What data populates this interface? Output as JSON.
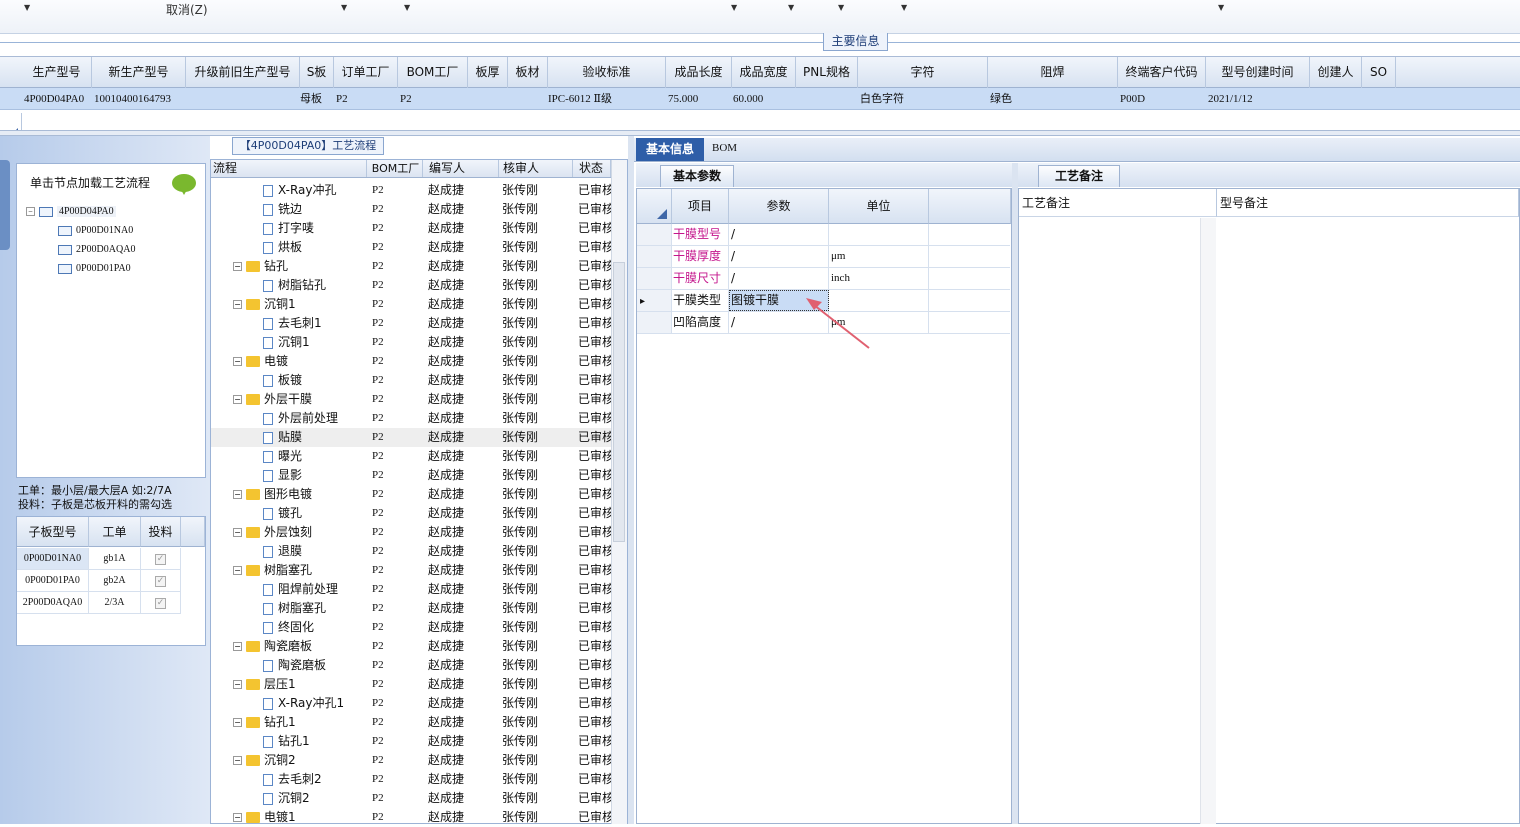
{
  "toolbar": {
    "cancel_label": "取消(Z)",
    "dropdown_glyph": "▼"
  },
  "main_info": {
    "title": "主要信息",
    "columns": [
      "生产型号",
      "新生产型号",
      "升级前旧生产型号",
      "S板",
      "订单工厂",
      "BOM工厂",
      "板厚",
      "板材",
      "验收标准",
      "成品长度",
      "成品宽度",
      "PNL规格",
      "字符",
      "阻焊",
      "终端客户代码",
      "型号创建时间",
      "创建人",
      "SO"
    ],
    "row": {
      "prod_no": "4P00D04PA0",
      "new_prod_no": "10010400164793",
      "s_board": "母板",
      "order_factory": "P2",
      "bom_factory": "P2",
      "standard": "IPC-6012 Ⅱ级",
      "length": "75.000",
      "width": "60.000",
      "char": "白色字符",
      "mask": "绿色",
      "customer": "P00D",
      "created": "2021/1/12"
    }
  },
  "left": {
    "load_hint": "单击节点加载工艺流程",
    "tree_root": "4P00D04PA0",
    "tree_children": [
      "0P00D01NA0",
      "2P00D0AQA0",
      "0P00D01PA0"
    ],
    "order_line1": "工单：最小层/最大层A 如:2/7A",
    "order_line2": "投料：子板是芯板开料的需勾选",
    "subgrid_headers": [
      "子板型号",
      "工单",
      "投料"
    ],
    "subgrid_rows": [
      {
        "model": "0P00D01NA0",
        "order": "gb1A",
        "checked": true
      },
      {
        "model": "0P00D01PA0",
        "order": "gb2A",
        "checked": true
      },
      {
        "model": "2P00D0AQA0",
        "order": "2/3A",
        "checked": true
      }
    ]
  },
  "process": {
    "title": "【4P00D04PA0】工艺流程",
    "headers": [
      "流程",
      "BOM工厂",
      "编写人",
      "核审人",
      "状态"
    ],
    "factory": "P2",
    "writer": "赵成捷",
    "reviewer": "张传刚",
    "status": "已审核",
    "rows": [
      {
        "name": "X-Ray冲孔",
        "type": "doc"
      },
      {
        "name": "铣边",
        "type": "doc"
      },
      {
        "name": "打字唛",
        "type": "doc"
      },
      {
        "name": "烘板",
        "type": "doc"
      },
      {
        "name": "钻孔",
        "type": "folder"
      },
      {
        "name": "树脂钻孔",
        "type": "doc"
      },
      {
        "name": "沉铜1",
        "type": "folder"
      },
      {
        "name": "去毛刺1",
        "type": "doc"
      },
      {
        "name": "沉铜1",
        "type": "doc"
      },
      {
        "name": "电镀",
        "type": "folder"
      },
      {
        "name": "板镀",
        "type": "doc"
      },
      {
        "name": "外层干膜",
        "type": "folder"
      },
      {
        "name": "外层前处理",
        "type": "doc"
      },
      {
        "name": "贴膜",
        "type": "doc",
        "selected": true
      },
      {
        "name": "曝光",
        "type": "doc"
      },
      {
        "name": "显影",
        "type": "doc"
      },
      {
        "name": "图形电镀",
        "type": "folder"
      },
      {
        "name": "镀孔",
        "type": "doc"
      },
      {
        "name": "外层蚀刻",
        "type": "folder"
      },
      {
        "name": "退膜",
        "type": "doc"
      },
      {
        "name": "树脂塞孔",
        "type": "folder"
      },
      {
        "name": "阻焊前处理",
        "type": "doc"
      },
      {
        "name": "树脂塞孔",
        "type": "doc"
      },
      {
        "name": "终固化",
        "type": "doc"
      },
      {
        "name": "陶瓷磨板",
        "type": "folder"
      },
      {
        "name": "陶瓷磨板",
        "type": "doc"
      },
      {
        "name": "层压1",
        "type": "folder"
      },
      {
        "name": "X-Ray冲孔1",
        "type": "doc"
      },
      {
        "name": "钻孔1",
        "type": "folder"
      },
      {
        "name": "钻孔1",
        "type": "doc"
      },
      {
        "name": "沉铜2",
        "type": "folder"
      },
      {
        "name": "去毛刺2",
        "type": "doc"
      },
      {
        "name": "沉铜2",
        "type": "doc"
      },
      {
        "name": "电镀1",
        "type": "folder"
      }
    ]
  },
  "right": {
    "tabs": [
      "基本信息",
      "BOM"
    ],
    "params_tab": "基本参数",
    "param_headers": [
      "项目",
      "参数",
      "单位"
    ],
    "params": [
      {
        "item": "干膜型号",
        "value": "/",
        "unit": "",
        "highlight": true
      },
      {
        "item": "干膜厚度",
        "value": "/",
        "unit": "μm",
        "highlight": true
      },
      {
        "item": "干膜尺寸",
        "value": "/",
        "unit": "inch",
        "highlight": true
      },
      {
        "item": "干膜类型",
        "value": "图镀干膜",
        "unit": "",
        "highlight": false,
        "current": true
      },
      {
        "item": "凹陷高度",
        "value": "/",
        "unit": "μm",
        "highlight": false
      }
    ],
    "notes_tab": "工艺备注",
    "note_headers": [
      "工艺备注",
      "型号备注"
    ]
  },
  "colors": {
    "accent": "#2e5ea8",
    "header_bg": "#d7e2f1",
    "selected_row": "#c9dcf5",
    "magenta": "#c4158c",
    "arrow": "#e06070"
  }
}
